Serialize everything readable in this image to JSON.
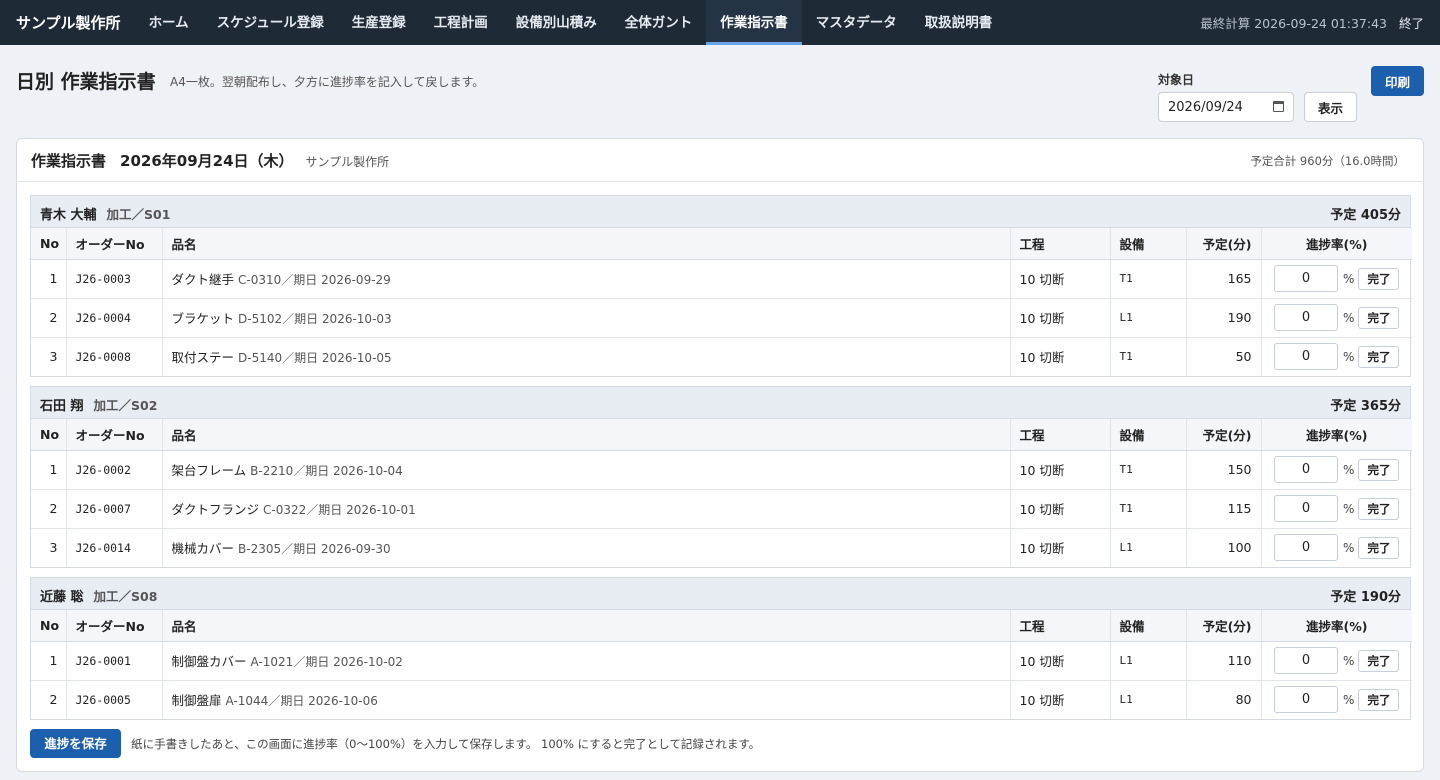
{
  "nav": {
    "brand": "サンプル製作所",
    "items": [
      "ホーム",
      "スケジュール登録",
      "生産登録",
      "工程計画",
      "設備別山積み",
      "全体ガント",
      "作業指示書",
      "マスタデータ",
      "取扱説明書"
    ],
    "active_index": 6,
    "last_calc": "最終計算 2026-09-24 01:37:43",
    "logout": "終了"
  },
  "header": {
    "title": "日別 作業指示書",
    "description": "A4一枚。翌朝配布し、夕方に進捗率を記入して戻します。",
    "date_label": "対象日",
    "date_value": "2026/09/24",
    "show_label": "表示",
    "print_label": "印刷"
  },
  "sheet": {
    "title": "作業指示書",
    "date": "2026年09月24日（木）",
    "company": "サンプル製作所",
    "total": "予定合計 960分（16.0時間）"
  },
  "columns": {
    "no": "No",
    "order": "オーダーNo",
    "item": "品名",
    "process": "工程",
    "equipment": "設備",
    "plan": "予定(分)",
    "progress": "進捗率(%)"
  },
  "units": {
    "pct": "%",
    "done": "完了"
  },
  "groups": [
    {
      "name": "青木 大輔",
      "work": "加工／S01",
      "total": "予定 405分",
      "rows": [
        {
          "no": "1",
          "order": "J26-0003",
          "item": "ダクト継手",
          "sub": "C-0310／期日 2026-09-29",
          "process": "10 切断",
          "equipment": "T1",
          "plan": "165",
          "progress": "0"
        },
        {
          "no": "2",
          "order": "J26-0004",
          "item": "ブラケット",
          "sub": "D-5102／期日 2026-10-03",
          "process": "10 切断",
          "equipment": "L1",
          "plan": "190",
          "progress": "0"
        },
        {
          "no": "3",
          "order": "J26-0008",
          "item": "取付ステー",
          "sub": "D-5140／期日 2026-10-05",
          "process": "10 切断",
          "equipment": "T1",
          "plan": "50",
          "progress": "0"
        }
      ]
    },
    {
      "name": "石田 翔",
      "work": "加工／S02",
      "total": "予定 365分",
      "rows": [
        {
          "no": "1",
          "order": "J26-0002",
          "item": "架台フレーム",
          "sub": "B-2210／期日 2026-10-04",
          "process": "10 切断",
          "equipment": "T1",
          "plan": "150",
          "progress": "0"
        },
        {
          "no": "2",
          "order": "J26-0007",
          "item": "ダクトフランジ",
          "sub": "C-0322／期日 2026-10-01",
          "process": "10 切断",
          "equipment": "T1",
          "plan": "115",
          "progress": "0"
        },
        {
          "no": "3",
          "order": "J26-0014",
          "item": "機械カバー",
          "sub": "B-2305／期日 2026-09-30",
          "process": "10 切断",
          "equipment": "L1",
          "plan": "100",
          "progress": "0"
        }
      ]
    },
    {
      "name": "近藤 聡",
      "work": "加工／S08",
      "total": "予定 190分",
      "rows": [
        {
          "no": "1",
          "order": "J26-0001",
          "item": "制御盤カバー",
          "sub": "A-1021／期日 2026-10-02",
          "process": "10 切断",
          "equipment": "L1",
          "plan": "110",
          "progress": "0"
        },
        {
          "no": "2",
          "order": "J26-0005",
          "item": "制御盤扉",
          "sub": "A-1044／期日 2026-10-06",
          "process": "10 切断",
          "equipment": "L1",
          "plan": "80",
          "progress": "0"
        }
      ]
    }
  ],
  "footer": {
    "save_label": "進捗を保存",
    "note": "紙に手書きしたあと、この画面に進捗率（0〜100%）を入力して保存します。 100% にすると完了として記録されます。"
  }
}
